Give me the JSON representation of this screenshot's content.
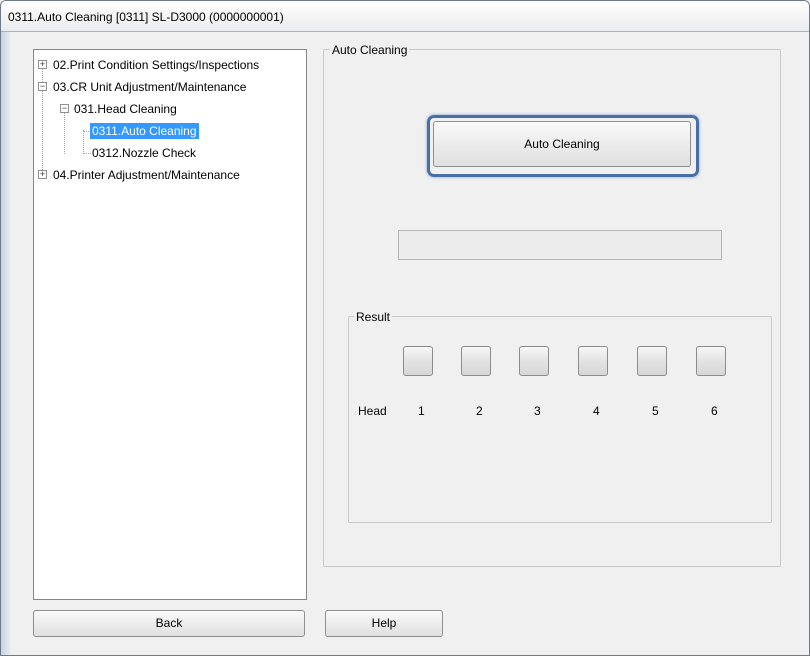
{
  "window": {
    "title": "0311.Auto Cleaning  [0311]  SL-D3000  (0000000001)"
  },
  "tree": {
    "nodes": [
      {
        "label": "02.Print Condition Settings/Inspections",
        "toggle": "+"
      },
      {
        "label": "03.CR Unit Adjustment/Maintenance",
        "toggle": "−"
      },
      {
        "label": "031.Head Cleaning",
        "toggle": "−"
      },
      {
        "label": "0311.Auto Cleaning",
        "selected": true
      },
      {
        "label": "0312.Nozzle Check"
      },
      {
        "label": "04.Printer Adjustment/Maintenance",
        "toggle": "+"
      }
    ]
  },
  "auto_cleaning": {
    "group_label": "Auto Cleaning",
    "button_label": "Auto Cleaning",
    "progress": 0
  },
  "result": {
    "group_label": "Result",
    "row_label": "Head",
    "heads": [
      "1",
      "2",
      "3",
      "4",
      "5",
      "6"
    ]
  },
  "footer": {
    "back_label": "Back",
    "help_label": "Help"
  },
  "colors": {
    "selection": "#3399ff",
    "focus_ring": "#4a6fa6",
    "progress_fill": "#06b025"
  }
}
